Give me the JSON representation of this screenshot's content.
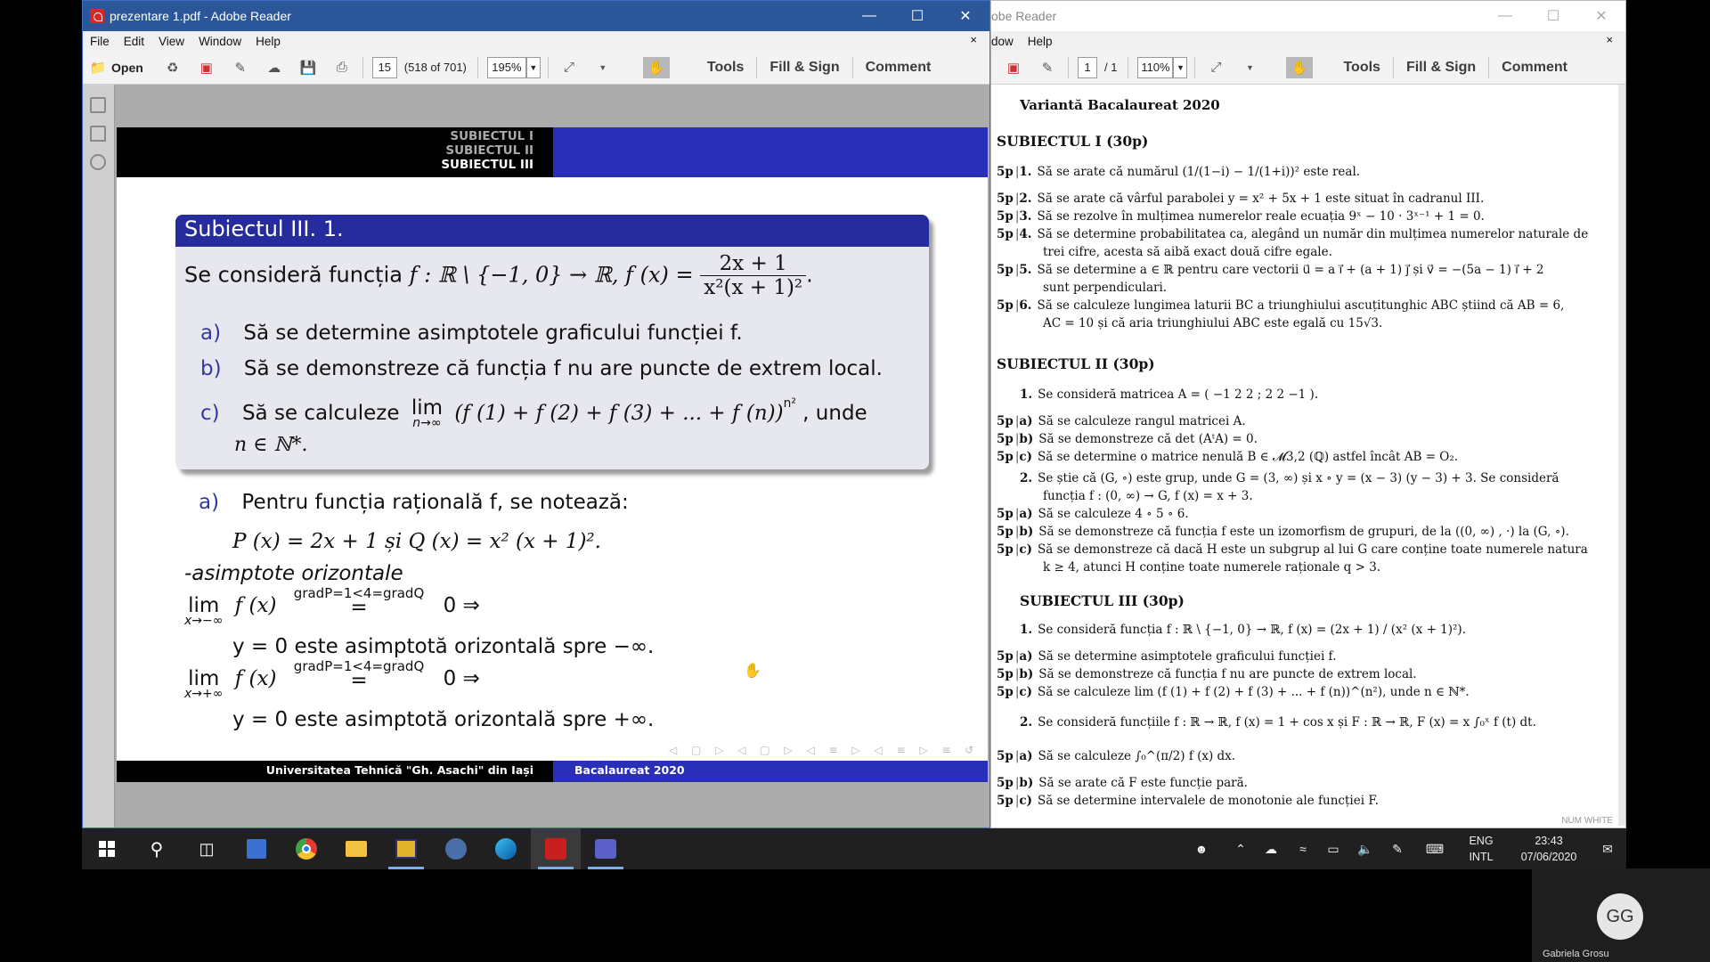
{
  "left_window": {
    "title": "prezentare 1.pdf - Adobe Reader",
    "menu": [
      "File",
      "Edit",
      "View",
      "Window",
      "Help"
    ],
    "close_panel": "×",
    "toolbar": {
      "open_label": "Open",
      "page_value": "15",
      "page_info": "(518 of 701)",
      "zoom": "195%",
      "tools": "Tools",
      "fill_sign": "Fill & Sign",
      "comment": "Comment"
    }
  },
  "slide": {
    "nav": [
      "SUBIECTUL I",
      "SUBIECTUL II",
      "SUBIECTUL III"
    ],
    "block_title": "Subiectul III.  1.",
    "statement_prefix": "Se consideră funcția",
    "statement_domain": "f : ℝ \\ {−1, 0} → ℝ, f (x) =",
    "frac_num": "2x + 1",
    "frac_den": "x²(x + 1)²",
    "item_a_label": "a)",
    "item_a": "Să se determine asimptotele graficului funcției f.",
    "item_b_label": "b)",
    "item_b": "Să se demonstreze că funcția f nu are puncte de extrem local.",
    "item_c_label": "c)",
    "item_c_start": "Să se calculeze",
    "item_c_lim": "lim",
    "item_c_sub": "n→∞",
    "item_c_expr": "(f (1) + f (2) + f (3) + ... + f (n))",
    "item_c_exp": "n²",
    "item_c_end": ", unde",
    "item_c_n": "n ∈ ℕ*.",
    "sol_a_label": "a)",
    "sol_a": "Pentru funcția rațională f, se notează:",
    "sol_pq": "P (x) = 2x + 1 și Q (x) = x² (x + 1)².",
    "sol_heading": "-asimptote orizontale",
    "lim1_sub": "x→−∞",
    "lim2_sub": "x→+∞",
    "lim_word": "lim",
    "lim_fx": "f (x)",
    "lim_over": "gradP=1<4=gradQ",
    "lim_eq": "=",
    "lim_res": "0 ⇒",
    "sol_line1": "y = 0 este asimptotă orizontală spre −∞.",
    "sol_line2": "y = 0 este asimptotă orizontală spre +∞.",
    "footer_left": "Universitatea Tehnică \"Gh. Asachi\" din Iași",
    "footer_right": "Bacalaureat 2020"
  },
  "right_window": {
    "title": "obe Reader",
    "menu": [
      "dow",
      "Help"
    ],
    "close_panel": "×",
    "toolbar": {
      "page_value": "1",
      "page_total": "/ 1",
      "zoom": "110%",
      "tools": "Tools",
      "fill_sign": "Fill & Sign",
      "comment": "Comment"
    },
    "doc_title": "Variantă Bacalaureat 2020",
    "s1_heading": "SUBIECTUL I (30p)",
    "s1": [
      {
        "pts": "5p",
        "n": "1.",
        "text": "Să se arate că numărul (1/(1−i) − 1/(1+i))² este real."
      },
      {
        "pts": "5p",
        "n": "2.",
        "text": "Să se arate că vârful parabolei y = x² + 5x + 1 este situat în cadranul III."
      },
      {
        "pts": "5p",
        "n": "3.",
        "text": "Să se rezolve în mulțimea numerelor reale ecuația 9ˣ − 10 · 3ˣ⁻¹ + 1 = 0."
      },
      {
        "pts": "5p",
        "n": "4.",
        "text": "Să se determine probabilitatea ca, alegând un număr din mulțimea numerelor naturale de"
      },
      {
        "pts": "",
        "n": "",
        "text": "trei cifre, acesta să aibă exact două cifre egale."
      },
      {
        "pts": "5p",
        "n": "5.",
        "text": "Să se determine a ∈ ℝ pentru care vectorii u⃗ = a i⃗ + (a + 1) j⃗ și v⃗ = −(5a − 1) i⃗ + 2"
      },
      {
        "pts": "",
        "n": "",
        "text": "sunt perpendiculari."
      },
      {
        "pts": "5p",
        "n": "6.",
        "text": "Să se calculeze lungimea laturii BC a triunghiului ascuțitunghic ABC știind că AB = 6,"
      },
      {
        "pts": "",
        "n": "",
        "text": "AC = 10 și că aria triunghiului ABC este egală cu 15√3."
      }
    ],
    "s2_heading": "SUBIECTUL II (30p)",
    "s2": [
      {
        "pts": "",
        "n": "1.",
        "text": "Se consideră matricea A = ( −1  2  2 ;  2  2  −1 )."
      },
      {
        "pts": "5p",
        "n": "a)",
        "text": "Să se calculeze rangul matricei A."
      },
      {
        "pts": "5p",
        "n": "b)",
        "text": "Să se demonstreze că det (AᵗA) = 0."
      },
      {
        "pts": "5p",
        "n": "c)",
        "text": "Să se determine o matrice nenulă B ∈ 𝓜3,2 (ℚ) astfel încât AB = O₂."
      },
      {
        "pts": "",
        "n": "2.",
        "text": "Se știe că (G, ∘) este grup, unde G = (3, ∞) și x ∘ y = (x − 3) (y − 3) + 3. Se consideră"
      },
      {
        "pts": "",
        "n": "",
        "text": "funcția f : (0, ∞) → G, f (x) = x + 3."
      },
      {
        "pts": "5p",
        "n": "a)",
        "text": "Să se calculeze 4 ∘ 5 ∘ 6."
      },
      {
        "pts": "5p",
        "n": "b)",
        "text": "Să se demonstreze că funcția f este un izomorfism de grupuri, de la ((0, ∞) , ·) la (G, ∘)."
      },
      {
        "pts": "5p",
        "n": "c)",
        "text": "Să se demonstreze că dacă H este un subgrup al lui G care conține toate numerele natura"
      },
      {
        "pts": "",
        "n": "",
        "text": "k ≥ 4, atunci H conține toate numerele raționale q > 3."
      }
    ],
    "s3_heading": "SUBIECTUL III (30p)",
    "s3": [
      {
        "pts": "",
        "n": "1.",
        "text": "Se consideră funcția f : ℝ \\ {−1, 0} → ℝ, f (x) = (2x + 1) / (x² (x + 1)²)."
      },
      {
        "pts": "5p",
        "n": "a)",
        "text": "Să se determine asimptotele graficului funcției f."
      },
      {
        "pts": "5p",
        "n": "b)",
        "text": "Să se demonstreze că funcția f nu are puncte de extrem local."
      },
      {
        "pts": "5p",
        "n": "c)",
        "text": "Să se calculeze lim (f (1) + f (2) + f (3) + ... + f (n))^(n²), unde n ∈ ℕ*."
      },
      {
        "pts": "",
        "n": "2.",
        "text": "Se consideră funcțiile f : ℝ → ℝ, f (x) = 1 + cos x și F : ℝ → ℝ, F (x) = x ∫₀ˣ f (t) dt."
      },
      {
        "pts": "5p",
        "n": "a)",
        "text": "Să se calculeze ∫₀^(π/2) f (x) dx."
      },
      {
        "pts": "5p",
        "n": "b)",
        "text": "Să se arate că F este funcție pară."
      },
      {
        "pts": "5p",
        "n": "c)",
        "text": "Să se determine intervalele de monotonie ale funcției F."
      }
    ],
    "status_bits": "NUM  WHITE"
  },
  "taskbar": {
    "lang_top": "ENG",
    "lang_bottom": "INTL",
    "time": "23:43",
    "date": "07/06/2020"
  },
  "camera": {
    "initials": "GG",
    "name": "Gabriela Grosu"
  }
}
